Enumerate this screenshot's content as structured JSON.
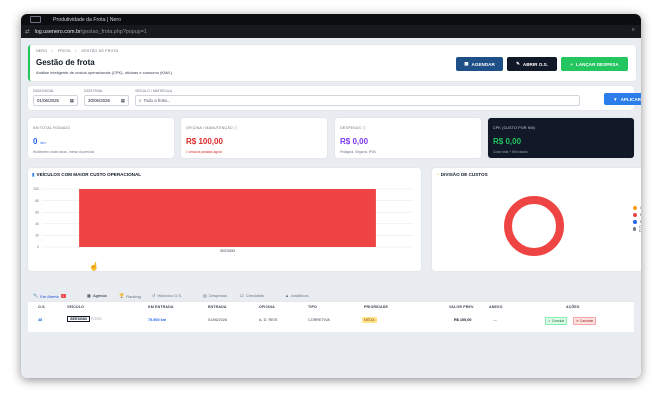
{
  "window": {
    "title": "Produtividade da Frota | Nero"
  },
  "url": {
    "host": "log.usenero.com.br",
    "path": "/gestao_frota.php?popup=1",
    "zoom_icon": "magnifier-icon"
  },
  "header": {
    "breadcrumb": [
      "NERO",
      "FROTA",
      "GESTÃO DE FROTA"
    ],
    "title": "Gestão de frota",
    "subtitle": "Análise inteligente de custos operacionais (CPK), oficinas e consumo (KM/L)",
    "buttons": {
      "agendar": "AGENDAR",
      "abrir": "ABRIR O.S.",
      "lancar": "LANÇAR DESPESA"
    }
  },
  "filters": {
    "start_label": "DATA INICIAL",
    "start_value": "01/06/2026",
    "end_label": "DATA FINAL",
    "end_value": "30/06/2026",
    "vehicle_label": "VEÍCULO / MATRÍCULA",
    "vehicle_value": "Todo a frota...",
    "apply": "APLICAR"
  },
  "kpis": [
    {
      "label": "KM TOTAL RODADO",
      "value": "0",
      "unit": "km",
      "sub": "Hodômetro: maior atual - menor do período",
      "color": "#2563eb"
    },
    {
      "label": "OFICINA / MANUTENÇÃO",
      "value": "R$ 100,00",
      "sub": "1 veículos parados agora",
      "color": "#dc2626",
      "sub_color": "#dc2626"
    },
    {
      "label": "DESPESAS",
      "value": "R$ 0,00",
      "sub": "Pedágios, Seguros, IPVA",
      "color": "#7c3aed"
    },
    {
      "label": "CPK (CUSTO POR KM)",
      "value": "R$ 0,00",
      "sub": "Custo total + KM rodado",
      "color": "#22c55e"
    }
  ],
  "chart1": {
    "title": "VEÍCULOS COM MAIOR CUSTO OPERACIONAL"
  },
  "chart_data": [
    {
      "type": "bar",
      "title": "VEÍCULOS COM MAIOR CUSTO OPERACIONAL",
      "categories": [
        "SEE3G83"
      ],
      "values": [
        100
      ],
      "ylim": [
        0,
        100
      ],
      "yticks": [
        0,
        20,
        40,
        60,
        80,
        100
      ],
      "color": "#ef4444",
      "grid": true
    },
    {
      "type": "pie",
      "title": "DIVISÃO DE CUSTOS",
      "labels": [
        "Combustível",
        "Manutenção",
        "Pedágio",
        "Outras Despesas"
      ],
      "values": [
        0,
        100,
        0,
        0
      ],
      "colors": [
        "#f59e0b",
        "#ef4444",
        "#2563eb",
        "#6b7280"
      ],
      "legend": "right"
    }
  ],
  "chart2": {
    "title": "DIVISÃO DE CUSTOS"
  },
  "tabs": [
    {
      "label": "Em Aberto",
      "badge": "1",
      "icon": "wrench-icon",
      "glyph": "🔧"
    },
    {
      "label": "Agenda",
      "icon": "calendar-icon",
      "glyph": "▦"
    },
    {
      "label": "Ranking",
      "icon": "trophy-icon",
      "glyph": "🏆"
    },
    {
      "label": "Histórico O.S.",
      "icon": "history-icon",
      "glyph": "↺"
    },
    {
      "label": "Despesas",
      "icon": "receipt-icon",
      "glyph": "▤"
    },
    {
      "label": "Checklists",
      "icon": "checklist-icon",
      "glyph": "☑"
    },
    {
      "label": "Analíticos",
      "icon": "chart-icon",
      "glyph": "▲"
    }
  ],
  "table": {
    "headers": [
      "O.S.",
      "VEÍCULO",
      "KM ENTRADA",
      "ENTRADA",
      "OFICINA",
      "TIPO",
      "PRIORIDADE",
      "VALOR PREV.",
      "ANEXO",
      "AÇÕES"
    ],
    "row": {
      "os": "48",
      "plate": "SEE3G83",
      "model": "FORD",
      "km": "75.500 km",
      "entrada": "01/06/2026",
      "oficina": "A. D. REIS",
      "tipo": "CORRETIVA",
      "prioridade": "MÉDIA",
      "valor": "R$ 100,00",
      "anexo": "—",
      "concluir": "Concluir",
      "cancelar": "Cancelar"
    }
  }
}
